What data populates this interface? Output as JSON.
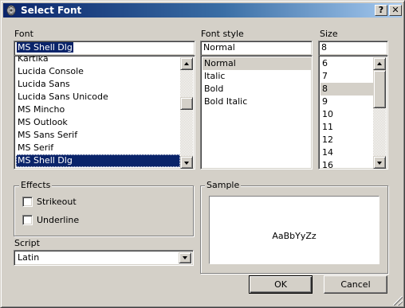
{
  "window": {
    "title": "Select Font",
    "help_label": "?",
    "close_label": "✕"
  },
  "font": {
    "label": "Font",
    "value": "MS Shell Dlg",
    "items": [
      "Kartika",
      "Lucida Console",
      "Lucida Sans",
      "Lucida Sans Unicode",
      "MS Mincho",
      "MS Outlook",
      "MS Sans Serif",
      "MS Serif",
      "MS Shell Dlg"
    ],
    "selected": "MS Shell Dlg"
  },
  "font_style": {
    "label": "Font style",
    "value": "Normal",
    "items": [
      "Normal",
      "Italic",
      "Bold",
      "Bold Italic"
    ],
    "selected": "Normal"
  },
  "size": {
    "label": "Size",
    "value": "8",
    "items": [
      "6",
      "7",
      "8",
      "9",
      "10",
      "11",
      "12",
      "14",
      "16"
    ],
    "selected": "8"
  },
  "effects": {
    "label": "Effects",
    "strikeout_label": "Strikeout",
    "strikeout_checked": false,
    "underline_label": "Underline",
    "underline_checked": false
  },
  "sample": {
    "label": "Sample",
    "text": "AaBbYyZz"
  },
  "script": {
    "label": "Script",
    "value": "Latin"
  },
  "buttons": {
    "ok_label": "OK",
    "cancel_label": "Cancel"
  },
  "colors": {
    "face": "#d4d0c8",
    "title_start": "#0a246a",
    "title_end": "#a6caf0",
    "selection": "#0a246a"
  }
}
